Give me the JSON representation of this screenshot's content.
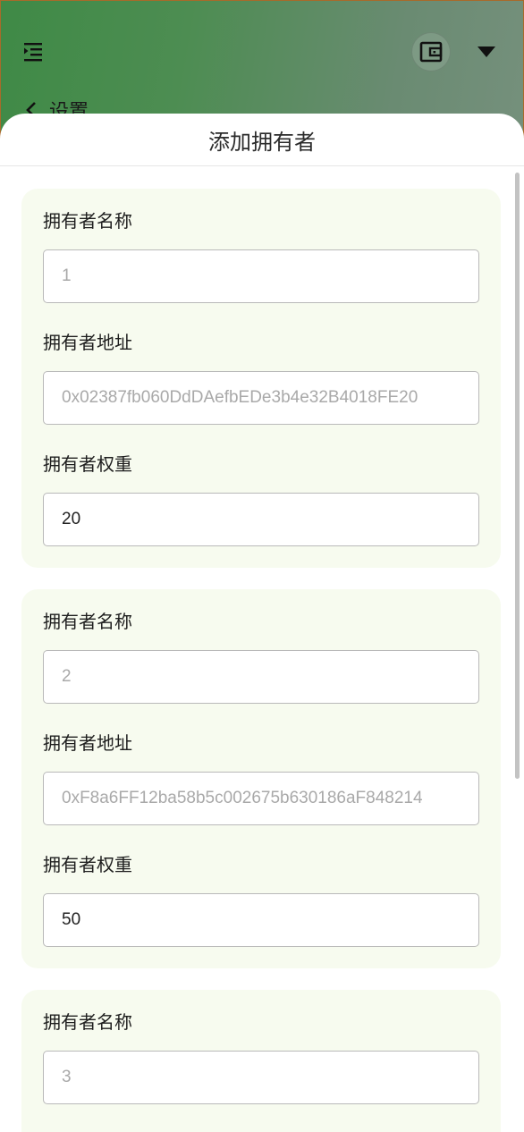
{
  "header": {
    "back_label": "设置",
    "colors": {
      "accent": "#3f8a46",
      "card_bg": "#f7fbef"
    }
  },
  "sheet": {
    "title": "添加拥有者"
  },
  "owners": [
    {
      "name_label": "拥有者名称",
      "name_placeholder": "1",
      "address_label": "拥有者地址",
      "address_placeholder": "0x02387fb060DdDAefbEDe3b4e32B4018FE20",
      "weight_label": "拥有者权重",
      "weight_value": "20"
    },
    {
      "name_label": "拥有者名称",
      "name_placeholder": "2",
      "address_label": "拥有者地址",
      "address_placeholder": "0xF8a6FF12ba58b5c002675b630186aF848214",
      "weight_label": "拥有者权重",
      "weight_value": "50"
    },
    {
      "name_label": "拥有者名称",
      "name_placeholder": "3"
    }
  ]
}
